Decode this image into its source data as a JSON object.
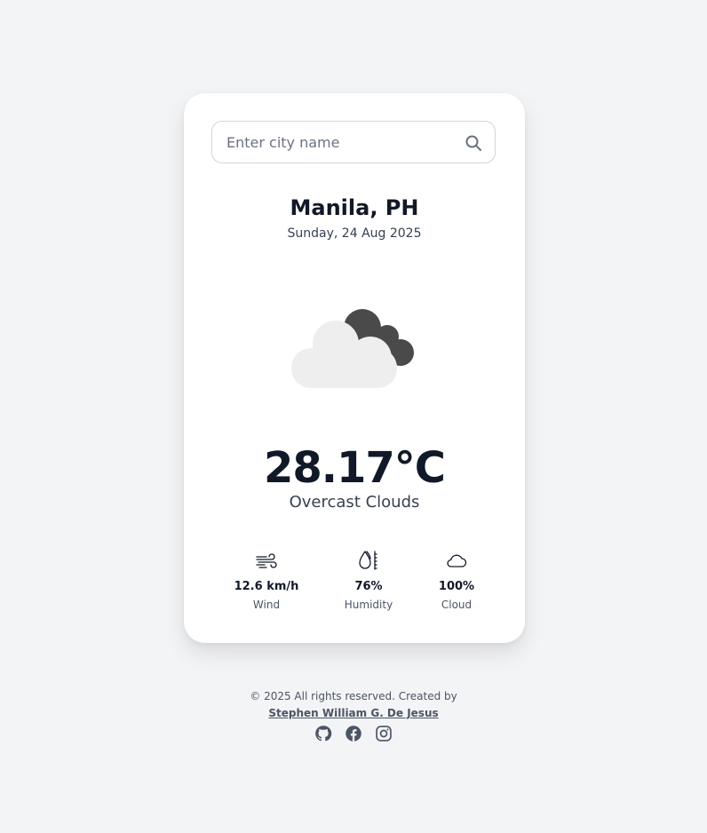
{
  "search": {
    "placeholder": "Enter city name",
    "value": ""
  },
  "location": {
    "city": "Manila, PH",
    "date": "Sunday, 24 Aug 2025"
  },
  "current": {
    "condition_icon": "overcast-clouds-icon",
    "temperature": "28.17°C",
    "description": "Overcast Clouds"
  },
  "stats": {
    "wind": {
      "icon": "wind-icon",
      "value": "12.6 km/h",
      "label": "Wind"
    },
    "humidity": {
      "icon": "humidity-icon",
      "value": "76%",
      "label": "Humidity"
    },
    "cloud": {
      "icon": "cloud-icon",
      "value": "100%",
      "label": "Cloud"
    }
  },
  "footer": {
    "copyright": "© 2025 All rights reserved. Created by",
    "author": "Stephen William G. De Jesus",
    "socials": [
      "github-icon",
      "facebook-icon",
      "instagram-icon"
    ]
  },
  "colors": {
    "background": "#f3f4f6",
    "card": "#ffffff",
    "text_primary": "#111827",
    "text_secondary": "#4b5563",
    "cloud_dark": "#4a4a4a",
    "cloud_light": "#eeeeee"
  }
}
